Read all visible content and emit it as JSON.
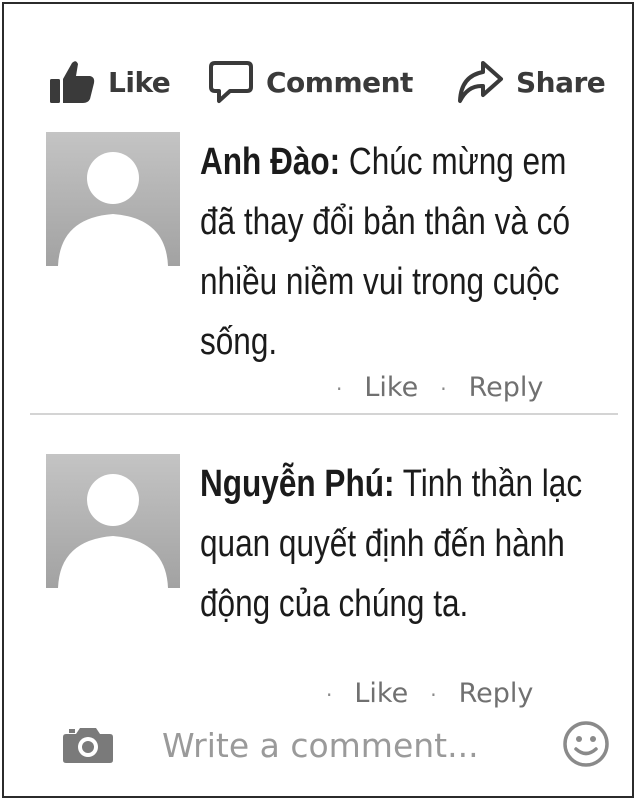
{
  "actions": {
    "like_label": "Like",
    "comment_label": "Comment",
    "share_label": "Share"
  },
  "comments": [
    {
      "author": "Anh Đào:",
      "text": "Chúc mừng em đã thay đổi bản thân và có nhiều niềm vui trong cuộc sống.",
      "like_label": "Like",
      "reply_label": "Reply"
    },
    {
      "author": "Nguyễn Phú:",
      "text": "Tinh thần lạc quan quyết định đến hành động của chúng ta.",
      "like_label": "Like",
      "reply_label": "Reply"
    }
  ],
  "composer": {
    "placeholder": "Write a comment..."
  },
  "icons": {
    "like": "thumbs-up-icon",
    "comment": "speech-bubble-icon",
    "share": "share-arrow-icon",
    "camera": "camera-icon",
    "emoji": "smiley-icon",
    "avatar": "default-avatar-icon"
  },
  "colors": {
    "text": "#1b1b1b",
    "muted": "#707070",
    "avatar_bg": "#b4b4b4"
  }
}
